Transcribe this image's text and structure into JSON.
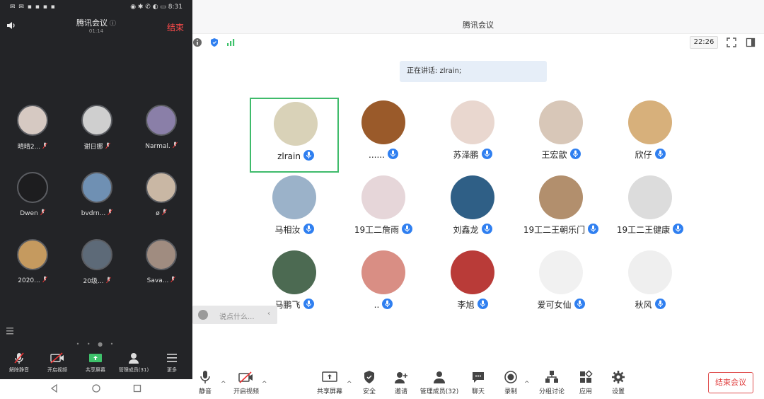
{
  "phone": {
    "status_left": "✉ ✉ ▪ ▪ ▪ ▪",
    "status_right": "◉ ✱ ✆ ◐ ▭ 8:31",
    "title": "腾讯会议",
    "title_info": "ⓘ",
    "elapsed": "01:14",
    "end_label": "结束",
    "participants": [
      {
        "name": "晴晴2..."
      },
      {
        "name": "谢日娜"
      },
      {
        "name": "Narmal."
      },
      {
        "name": "Dwen"
      },
      {
        "name": "bvdrn..."
      },
      {
        "name": "ø"
      },
      {
        "name": "2020..."
      },
      {
        "name": "20级..."
      },
      {
        "name": "Sava..."
      }
    ],
    "page_dots": "• • ● •",
    "toolbar": {
      "unmute": "解除静音",
      "start_video": "开启视频",
      "share_screen": "共享屏幕",
      "manage_members": "管理成员(31)",
      "more": "更多"
    }
  },
  "desktop": {
    "window_title": "腾讯会议",
    "clock": "22:26",
    "speaking_text": "正在讲话: zlrain;",
    "participants": [
      {
        "name": "zlrain",
        "color": "#d9d2b8"
      },
      {
        "name": "......",
        "color": "#9a5a2a"
      },
      {
        "name": "苏泽鹏",
        "color": "#e9d7cf"
      },
      {
        "name": "王宏歆",
        "color": "#d8c7b8"
      },
      {
        "name": "欣仔",
        "color": "#d7b07b"
      },
      {
        "name": "马相汝",
        "color": "#9bb2c9"
      },
      {
        "name": "19工二詹雨",
        "color": "#e6d6d9"
      },
      {
        "name": "刘鑫龙",
        "color": "#2f5f86"
      },
      {
        "name": "19工二王朝乐门",
        "color": "#b28f6d"
      },
      {
        "name": "19工二王健康",
        "color": "#dcdcdc"
      },
      {
        "name": "马鹏飞",
        "color": "#4c6a52"
      },
      {
        "name": "..",
        "color": "#d98e84"
      },
      {
        "name": "李旭",
        "color": "#b93b38"
      },
      {
        "name": "爱可女仙",
        "color": "#f1f1f1"
      },
      {
        "name": "秋风",
        "color": "#efefef"
      }
    ],
    "chat_placeholder": "说点什么...",
    "chat_arrow": "‹",
    "toolbar": {
      "mute": "静音",
      "start_video": "开启视频",
      "share_screen": "共享屏幕",
      "security": "安全",
      "invite": "邀请",
      "manage_members": "管理成员(32)",
      "chat": "聊天",
      "record": "录制",
      "breakout": "分组讨论",
      "apps": "应用",
      "settings": "设置"
    },
    "end_meeting": "结束会议"
  },
  "colors": {
    "accent_blue": "#2f7ff0",
    "active_speaker_border": "#3fbb6b",
    "end_red": "#e03e3e",
    "phone_bg": "#232427"
  }
}
